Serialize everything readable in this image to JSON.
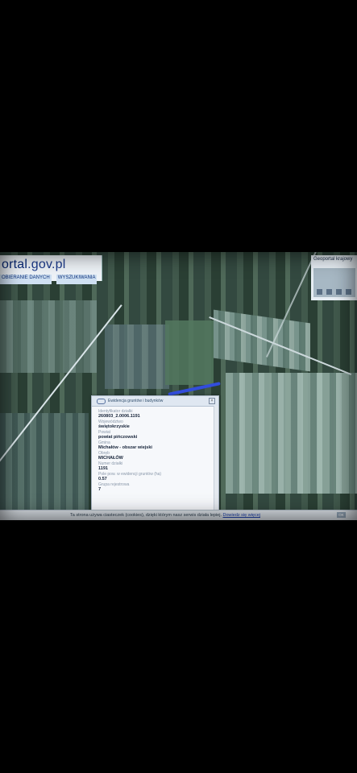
{
  "header": {
    "logo_text": "ortal",
    "logo_suffix": ".gov.pl",
    "nav_items": [
      "OBIERANIE DANYCH",
      "WYSZUKIWANIA"
    ]
  },
  "geoportal_panel": {
    "title": "Geoportal krajowy"
  },
  "popup": {
    "title": "Ewidencja gruntów i budynków",
    "fields": [
      {
        "label": "Identyfikator działki",
        "value": "260803_2.0006.1191"
      },
      {
        "label": "Województwo",
        "value": "świętokrzyskie"
      },
      {
        "label": "Powiat",
        "value": "powiat pińczowski"
      },
      {
        "label": "Gmina",
        "value": "Michałów - obszar wiejski"
      },
      {
        "label": "Obręb",
        "value": "MICHAŁÓW"
      },
      {
        "label": "Numer działki",
        "value": "1191"
      },
      {
        "label": "Pole pow. w ewidencji gruntów (ha)",
        "value": "0.57"
      },
      {
        "label": "Grupa rejestrowa",
        "value": "7"
      }
    ]
  },
  "cookie_bar": {
    "message": "Ta strona używa ciasteczek (cookies), dzięki którym nasz serwis działa lepiej.",
    "link": "Dowiedz się więcej",
    "close": "OK"
  }
}
